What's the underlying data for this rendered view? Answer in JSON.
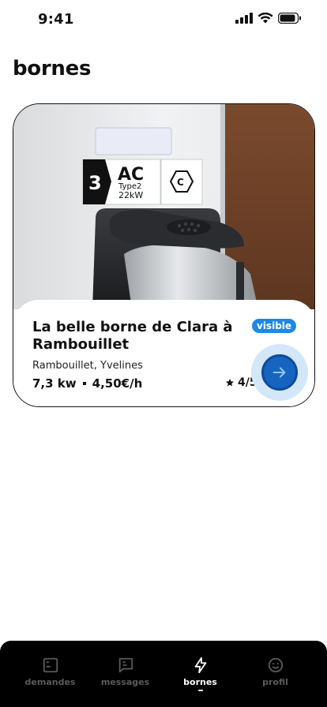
{
  "status_bar": {
    "time": "9:41",
    "icons": [
      "signal-icon",
      "wifi-icon",
      "battery-icon"
    ]
  },
  "page": {
    "title": "bornes"
  },
  "card": {
    "title": "La belle borne de Clara à Rambouillet",
    "badge": "visible",
    "location": "Rambouillet, Yvelines",
    "power": "7,3 kw",
    "price": "4,50€/h",
    "rating": "4/5",
    "photo_labels": {
      "number": "3",
      "current": "AC",
      "connector": "Type2",
      "power": "22kW",
      "plug_code": "C"
    }
  },
  "tabs": [
    {
      "label": "demandes",
      "icon": "inbox-icon",
      "active": false
    },
    {
      "label": "messages",
      "icon": "message-icon",
      "active": false
    },
    {
      "label": "bornes",
      "icon": "lightning-icon",
      "active": true
    },
    {
      "label": "profil",
      "icon": "smiley-icon",
      "active": false
    }
  ],
  "colors": {
    "accent": "#1e88e5",
    "button": "#1565c0",
    "tabbar": "#000000"
  }
}
